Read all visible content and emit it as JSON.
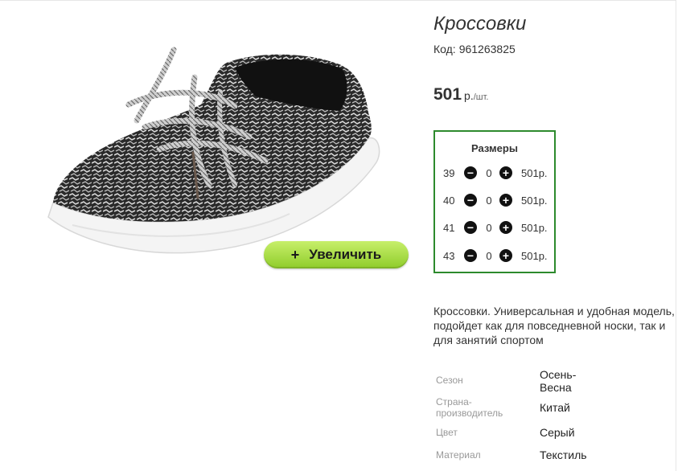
{
  "product": {
    "title": "Кроссовки",
    "code_label": "Код:",
    "code": "961263825",
    "price": "501",
    "currency": "р.",
    "unit": "/шт."
  },
  "zoom_button": {
    "icon": "plus-icon",
    "label": "Увеличить"
  },
  "sizes": {
    "title": "Размеры",
    "rows": [
      {
        "size": "39",
        "qty": "0",
        "price": "501р."
      },
      {
        "size": "40",
        "qty": "0",
        "price": "501р."
      },
      {
        "size": "41",
        "qty": "0",
        "price": "501р."
      },
      {
        "size": "43",
        "qty": "0",
        "price": "501р."
      }
    ]
  },
  "description": "Кроссовки. Универсальная и удобная модель, подойдет как для повседневной носки, так и для занятий спортом",
  "specs": [
    {
      "label": "Сезон",
      "value": "Осень-Весна"
    },
    {
      "label": "Страна-производитель",
      "value": "Китай"
    },
    {
      "label": "Цвет",
      "value": "Серый"
    },
    {
      "label": "Материал",
      "value": "Текстиль"
    }
  ],
  "colors": {
    "accent_green": "#2d8a2d",
    "button_green": "#9ed53a"
  }
}
